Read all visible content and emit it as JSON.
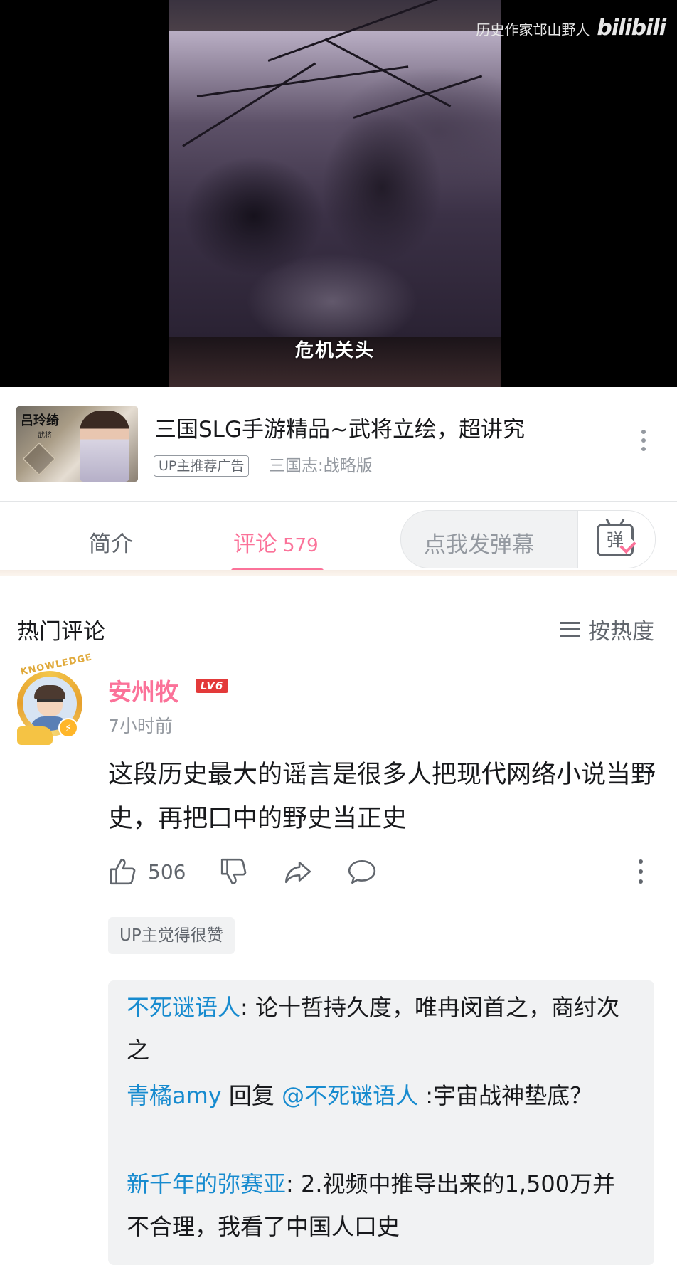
{
  "video": {
    "subtitle": "危机关头",
    "watermark_text": "历史作家邙山野人",
    "watermark_logo": "bilibili"
  },
  "ad": {
    "thumb_text": "吕玲绮",
    "thumb_sub": "武将",
    "title": "三国SLG手游精品~武将立绘，超讲究",
    "tag": "UP主推荐广告",
    "source": "三国志:战略版"
  },
  "tabs": {
    "intro_label": "简介",
    "comments_label": "评论",
    "comments_count": "579",
    "danmaku_placeholder": "点我发弹幕",
    "danmaku_icon_char": "弹"
  },
  "comments": {
    "section_title": "热门评论",
    "sort_label": "按热度",
    "top": {
      "avatar_badge": "KNOWLEDGE",
      "username": "安州牧",
      "level": "LV6",
      "time": "7小时前",
      "text": "这段历史最大的谣言是很多人把现代网络小说当野史，再把口中的野史当正史",
      "likes": "506",
      "up_badge": "UP主觉得很赞"
    },
    "replies": [
      {
        "name": "不死谜语人",
        "sep": ": ",
        "text": "论十哲持久度，唯冉闵首之，商纣次之",
        "reply_word": "",
        "reply_to": ""
      },
      {
        "name": "青橘amy",
        "sep": " ",
        "reply_word": "回复 ",
        "reply_to": "@不死谜语人",
        "text": " :宇宙战神垫底？"
      },
      {
        "name": "新千年的弥赛亚",
        "sep": ": ",
        "text": "2.视频中推导出来的1,500万并不合理，我看了中国人口史",
        "reply_word": "",
        "reply_to": ""
      }
    ]
  }
}
